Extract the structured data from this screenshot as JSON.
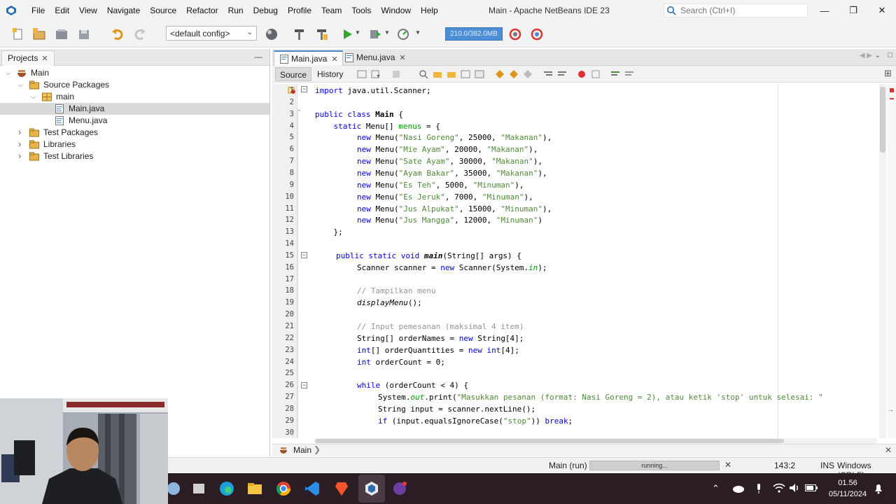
{
  "window": {
    "title": "Main - Apache NetBeans IDE 23",
    "search_placeholder": "Search (Ctrl+I)",
    "menu": [
      "File",
      "Edit",
      "View",
      "Navigate",
      "Source",
      "Refactor",
      "Run",
      "Debug",
      "Profile",
      "Team",
      "Tools",
      "Window",
      "Help"
    ]
  },
  "toolbar": {
    "config_value": "<default config>",
    "memory": "210.0/382.0MB"
  },
  "projects": {
    "tab_label": "Projects",
    "tree": [
      {
        "label": "Main",
        "icon": "project-icon",
        "level": 0,
        "expanded": true
      },
      {
        "label": "Source Packages",
        "icon": "folder-icon",
        "level": 1,
        "expanded": true
      },
      {
        "label": "main",
        "icon": "package-icon",
        "level": 2,
        "expanded": true
      },
      {
        "label": "Main.java",
        "icon": "java-file-icon",
        "level": 3,
        "selected": true
      },
      {
        "label": "Menu.java",
        "icon": "java-file-icon",
        "level": 3
      },
      {
        "label": "Test Packages",
        "icon": "folder-icon",
        "level": 1,
        "expanded": false
      },
      {
        "label": "Libraries",
        "icon": "folder-icon",
        "level": 1,
        "expanded": false
      },
      {
        "label": "Test Libraries",
        "icon": "folder-icon",
        "level": 1,
        "expanded": false
      }
    ]
  },
  "editor": {
    "tabs": [
      "Main.java",
      "Menu.java"
    ],
    "active_tab": "Main.java",
    "source_label": "Source",
    "history_label": "History",
    "breadcrumb": "Main",
    "line_numbers": [
      "1",
      "2",
      "3",
      "4",
      "5",
      "6",
      "7",
      "8",
      "9",
      "10",
      "11",
      "12",
      "13",
      "14",
      "15",
      "16",
      "17",
      "18",
      "19",
      "20",
      "21",
      "22",
      "23",
      "24",
      "25",
      "26",
      "27",
      "28",
      "29",
      "30"
    ],
    "code": {
      "l1": [
        "import",
        " java.util.Scanner;"
      ],
      "l3": [
        "public class",
        " ",
        "Main",
        " {"
      ],
      "l4": [
        "    static",
        " Menu[] ",
        "menus",
        " = {"
      ],
      "menu_items": [
        [
          "\"Nasi Goreng\"",
          "25000",
          "\"Makanan\"",
          "),"
        ],
        [
          "\"Mie Ayam\"",
          "20000",
          "\"Makanan\"",
          "),"
        ],
        [
          "\"Sate Ayam\"",
          "30000",
          "\"Makanan\"",
          "),"
        ],
        [
          "\"Ayam Bakar\"",
          "35000",
          "\"Makanan\"",
          "),"
        ],
        [
          "\"Es Teh\"",
          "5000",
          "\"Minuman\"",
          "),"
        ],
        [
          "\"Es Jeruk\"",
          "7000",
          "\"Minuman\"",
          "),"
        ],
        [
          "\"Jus Alpukat\"",
          "15000",
          "\"Minuman\"",
          "),"
        ],
        [
          "\"Jus Mangga\"",
          "12000",
          "\"Minuman\"",
          ")"
        ]
      ],
      "l13": "    };",
      "l15": [
        "public static void",
        " ",
        "main",
        "(String[] args) {"
      ],
      "l16": [
        "Scanner scanner = ",
        "new",
        " Scanner(System.",
        "in",
        ");"
      ],
      "l18": "// Tampilkan menu",
      "l19": [
        "displayMenu",
        "();"
      ],
      "l21": "// Input pemesanan (maksimal 4 item)",
      "l22": [
        "String[] orderNames = ",
        "new",
        " String[4];"
      ],
      "l23": [
        "int",
        "[] orderQuantities = ",
        "new",
        " ",
        "int",
        "[4];"
      ],
      "l24": [
        "int",
        " orderCount = 0;"
      ],
      "l26": [
        "while",
        " (orderCount < 4) {"
      ],
      "l27": [
        "System.",
        "out",
        ".print(",
        "\"Masukkan pesanan (format: Nasi Goreng = 2), atau ketik 'stop' untuk selesai: \""
      ],
      "l28": "String input = scanner.nextLine();",
      "l29": [
        "if",
        " (input.equalsIgnoreCase(",
        "\"stop\"",
        ")) ",
        "break",
        ";"
      ]
    }
  },
  "status": {
    "run_label": "Main (run)",
    "progress_label": "running...",
    "position": "143:2",
    "mode": "INS",
    "line_ending": "Windows (CRLF)"
  },
  "taskbar": {
    "time": "01.56",
    "date": "05/11/2024"
  }
}
